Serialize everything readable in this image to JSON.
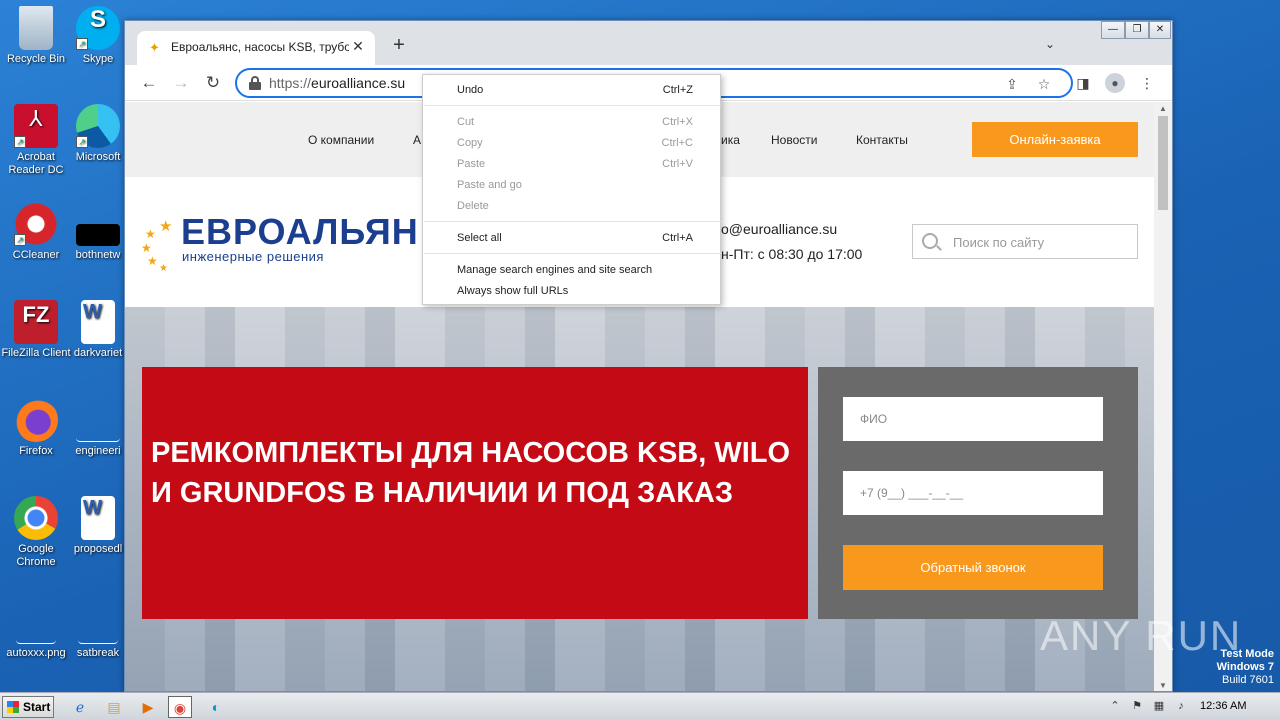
{
  "desktop": {
    "icons": [
      {
        "label": "Recycle Bin",
        "icon": "recycle-bin-icon"
      },
      {
        "label": "Skype",
        "icon": "skype-icon"
      },
      {
        "label": "Acrobat Reader DC",
        "icon": "acrobat-icon"
      },
      {
        "label": "Microsoft",
        "icon": "edge-icon"
      },
      {
        "label": "CCleaner",
        "icon": "ccleaner-icon"
      },
      {
        "label": "bothnetw",
        "icon": "file-icon"
      },
      {
        "label": "FileZilla Client",
        "icon": "filezilla-icon"
      },
      {
        "label": "darkvariet",
        "icon": "word-doc-icon"
      },
      {
        "label": "Firefox",
        "icon": "firefox-icon"
      },
      {
        "label": "engineeri",
        "icon": "file-icon"
      },
      {
        "label": "Google Chrome",
        "icon": "chrome-icon"
      },
      {
        "label": "proposedl",
        "icon": "word-doc-icon"
      },
      {
        "label": "autoxxx.png",
        "icon": "image-file-icon"
      },
      {
        "label": "satbreak",
        "icon": "file-icon"
      }
    ]
  },
  "browser": {
    "tab": {
      "title": "Евроальянс, насосы KSB, трубопр",
      "close": "✕"
    },
    "new_tab": "+",
    "url_scheme": "https://",
    "url_host": "euroalliance.su",
    "window_controls": {
      "minimize": "—",
      "restore": "❐",
      "close": "✕"
    }
  },
  "site": {
    "nav": [
      "О компании",
      "А",
      "ика",
      "Новости",
      "Контакты"
    ],
    "order_button": "Онлайн-заявка",
    "logo_main": "ЕВРОАЛЬЯН",
    "logo_sub": "инженерные решения",
    "email": "o@euroalliance.su",
    "hours": "н-Пт: с 08:30 до 17:00",
    "search_placeholder": "Поиск по сайту",
    "hero_title": "РЕМКОМПЛЕКТЫ ДЛЯ НАСОСОВ KSB, WILO И GRUNDFOS В НАЛИЧИИ И ПОД ЗАКАЗ",
    "form": {
      "name_placeholder": "ФИО",
      "phone_placeholder": "+7 (9__) ___-__-__",
      "callback_button": "Обратный звонок"
    }
  },
  "context_menu": {
    "items": [
      {
        "label": "Undo",
        "shortcut": "Ctrl+Z",
        "enabled": true
      },
      {
        "label": "Cut",
        "shortcut": "Ctrl+X",
        "enabled": false
      },
      {
        "label": "Copy",
        "shortcut": "Ctrl+C",
        "enabled": false
      },
      {
        "label": "Paste",
        "shortcut": "Ctrl+V",
        "enabled": false
      },
      {
        "label": "Paste and go",
        "shortcut": "",
        "enabled": false
      },
      {
        "label": "Delete",
        "shortcut": "",
        "enabled": false
      },
      {
        "label": "Select all",
        "shortcut": "Ctrl+A",
        "enabled": true
      },
      {
        "label": "Manage search engines and site search",
        "shortcut": "",
        "enabled": true
      },
      {
        "label": "Always show full URLs",
        "shortcut": "",
        "enabled": true
      }
    ]
  },
  "watermark": "ANY RUN",
  "os": {
    "test_mode": "Test Mode",
    "edition": "Windows 7",
    "build": "Build 7601",
    "start": "Start",
    "clock": "12:36 AM"
  },
  "colors": {
    "accent_orange": "#f8991d",
    "hero_red": "#c40a14",
    "brand_blue": "#1b3f8e",
    "omnibox_focus": "#1a73e8"
  }
}
